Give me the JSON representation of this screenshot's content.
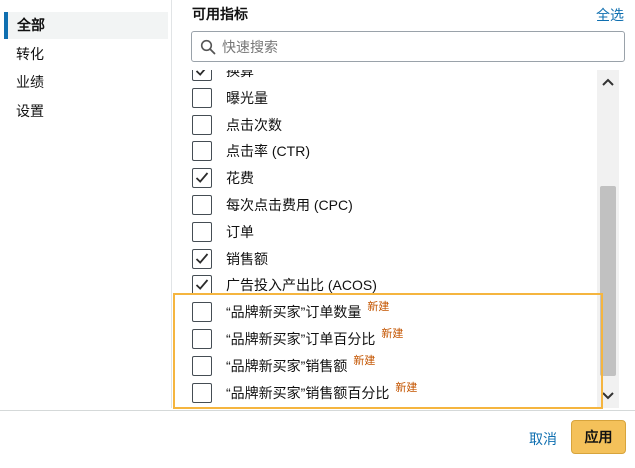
{
  "sidebar": {
    "items": [
      {
        "label": "全部",
        "active": true
      },
      {
        "label": "转化",
        "active": false
      },
      {
        "label": "业绩",
        "active": false
      },
      {
        "label": "设置",
        "active": false
      }
    ]
  },
  "panel": {
    "title": "可用指标",
    "select_all": "全选"
  },
  "search": {
    "placeholder": "快速搜索",
    "value": ""
  },
  "metrics": [
    {
      "label": "换算",
      "checked": true
    },
    {
      "label": "曝光量",
      "checked": false
    },
    {
      "label": "点击次数",
      "checked": false
    },
    {
      "label": "点击率 (CTR)",
      "checked": false
    },
    {
      "label": "花费",
      "checked": true
    },
    {
      "label": "每次点击费用 (CPC)",
      "checked": false
    },
    {
      "label": "订单",
      "checked": false
    },
    {
      "label": "销售额",
      "checked": true
    },
    {
      "label": "广告投入产出比 (ACOS)",
      "checked": true
    },
    {
      "label": "“品牌新买家”订单数量",
      "checked": false,
      "badge": "新建"
    },
    {
      "label": "“品牌新买家”订单百分比",
      "checked": false,
      "badge": "新建"
    },
    {
      "label": "“品牌新买家”销售额",
      "checked": false,
      "badge": "新建"
    },
    {
      "label": "“品牌新买家”销售额百分比",
      "checked": false,
      "badge": "新建"
    }
  ],
  "footer": {
    "cancel_label": "取消",
    "apply_label": "应用"
  },
  "colors": {
    "link": "#0f6fb0",
    "apply_bg": "#f4c15a",
    "highlight": "#f5b53f",
    "badge": "#c45500"
  }
}
